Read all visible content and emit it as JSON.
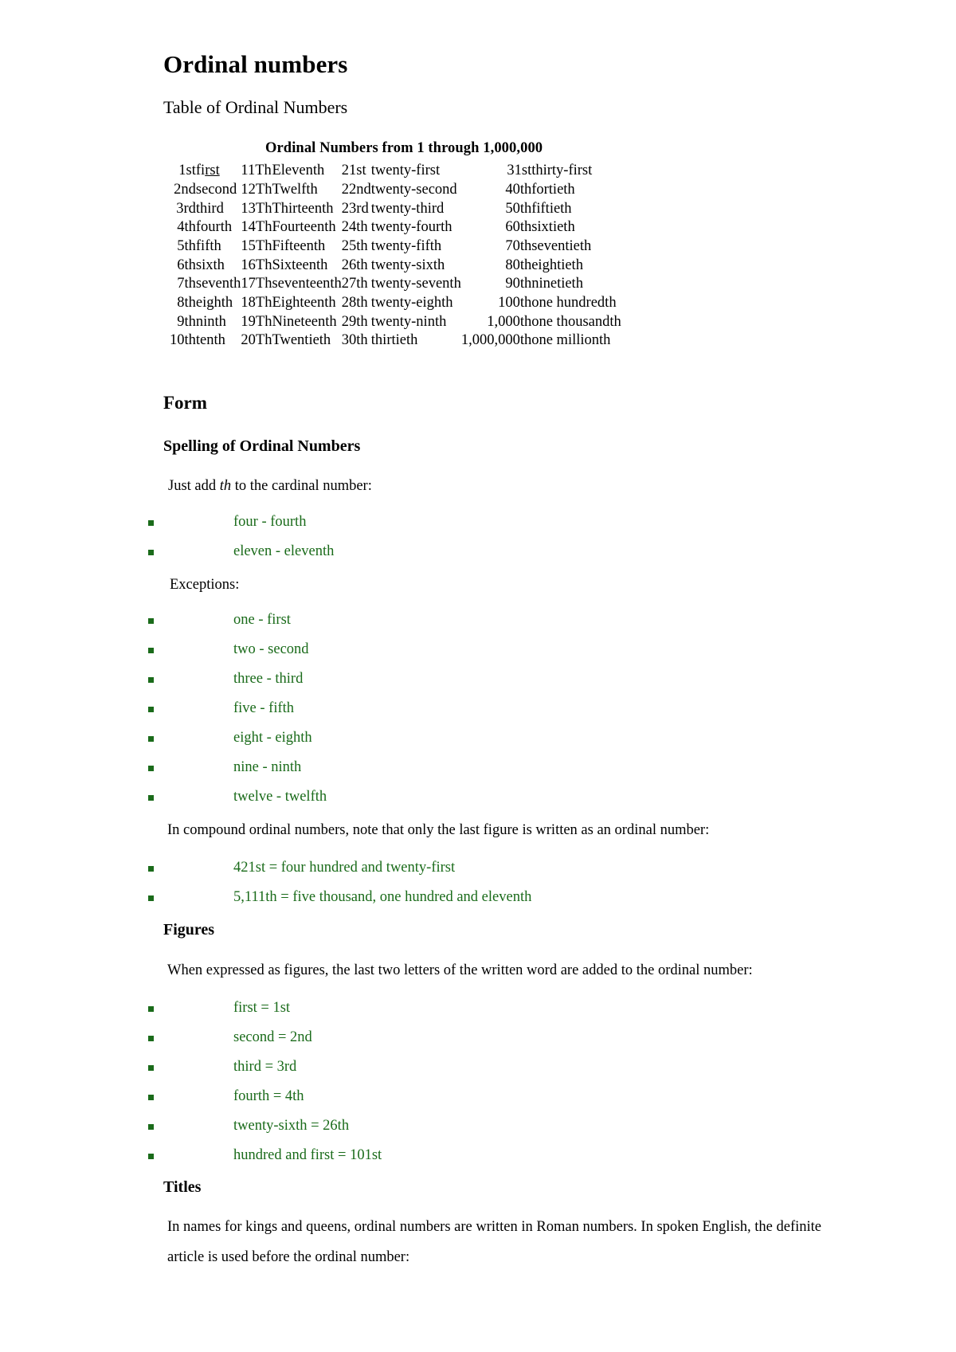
{
  "document": {
    "title": "Ordinal numbers",
    "subtitle": "Table of Ordinal Numbers"
  },
  "table": {
    "caption": "Ordinal Numbers from 1 through 1,000,000",
    "rows": [
      {
        "c1n": "1st",
        "c1w": "first",
        "c1w_underline_tail": "rst",
        "c2n": "11Th",
        "c2w": "Eleventh",
        "c3n": "21st",
        "c3w": "twenty-first",
        "c4n": "31st",
        "c4w": "thirty-first"
      },
      {
        "c1n": "2nd",
        "c1w": "second",
        "c2n": "12Th",
        "c2w": "Twelfth",
        "c3n": "22nd",
        "c3w": "twenty-second",
        "c4n": "40th",
        "c4w": "fortieth"
      },
      {
        "c1n": "3rd",
        "c1w": "third",
        "c2n": "13Th",
        "c2w": "Thirteenth",
        "c3n": "23rd",
        "c3w": "twenty-third",
        "c4n": "50th",
        "c4w": "fiftieth"
      },
      {
        "c1n": "4th",
        "c1w": "fourth",
        "c2n": "14Th",
        "c2w": "Fourteenth",
        "c3n": "24th",
        "c3w": "twenty-fourth",
        "c4n": "60th",
        "c4w": "sixtieth"
      },
      {
        "c1n": "5th",
        "c1w": "fifth",
        "c2n": "15Th",
        "c2w": "Fifteenth",
        "c3n": "25th",
        "c3w": "twenty-fifth",
        "c4n": "70th",
        "c4w": "seventieth"
      },
      {
        "c1n": "6th",
        "c1w": "sixth",
        "c2n": "16Th",
        "c2w": "Sixteenth",
        "c3n": "26th",
        "c3w": "twenty-sixth",
        "c4n": "80th",
        "c4w": "eightieth"
      },
      {
        "c1n": "7th",
        "c1w": "seventh",
        "c2n": "17Th",
        "c2w": "seventeenth",
        "c3n": "27th",
        "c3w": "twenty-seventh",
        "c4n": "90th",
        "c4w": "ninetieth"
      },
      {
        "c1n": "8th",
        "c1w": "eighth",
        "c2n": "18Th",
        "c2w": "Eighteenth",
        "c3n": "28th",
        "c3w": "twenty-eighth",
        "c4n": "100th",
        "c4w": "one hundredth"
      },
      {
        "c1n": "9th",
        "c1w": "ninth",
        "c2n": "19Th",
        "c2w": "Nineteenth",
        "c3n": "29th",
        "c3w": "twenty-ninth",
        "c4n": "1,000th",
        "c4w": "one thousandth"
      },
      {
        "c1n": "10th",
        "c1w": "tenth",
        "c2n": "20Th",
        "c2w": "Twentieth",
        "c3n": "30th",
        "c3w": "thirtieth",
        "c4n": "1,000,000th",
        "c4w": "one millionth"
      }
    ]
  },
  "sections": {
    "form": {
      "heading": "Form",
      "spelling": {
        "heading": "Spelling of Ordinal Numbers",
        "intro_before": "Just add ",
        "intro_italic": "th",
        "intro_after": " to the cardinal number:",
        "add_th_items": [
          "four - fourth",
          "eleven - eleventh"
        ],
        "exceptions_label": "Exceptions:",
        "exception_items": [
          "one - first",
          "two - second",
          "three - third",
          "five - fifth",
          "eight - eighth",
          "nine - ninth",
          "twelve - twelfth"
        ],
        "compound_note": "In compound ordinal numbers, note that only the last figure is written as an ordinal number:",
        "compound_items": [
          "421st = four hundred and twenty-first",
          "5,111th = five thousand, one hundred and eleventh"
        ]
      },
      "figures": {
        "heading": "Figures",
        "intro": "When expressed as figures, the last two letters of the written word are added to the ordinal number:",
        "items": [
          "first = 1st",
          "second = 2nd",
          "third = 3rd",
          "fourth = 4th",
          "twenty-sixth = 26th",
          "hundred and first = 101st"
        ]
      },
      "titles": {
        "heading": "Titles",
        "paragraph": "In names for kings and queens, ordinal numbers are written in Roman numbers. In spoken English, the definite article is used before the ordinal number:"
      }
    }
  },
  "colors": {
    "green": "#1a6b1a",
    "text": "#000000",
    "background": "#ffffff"
  }
}
